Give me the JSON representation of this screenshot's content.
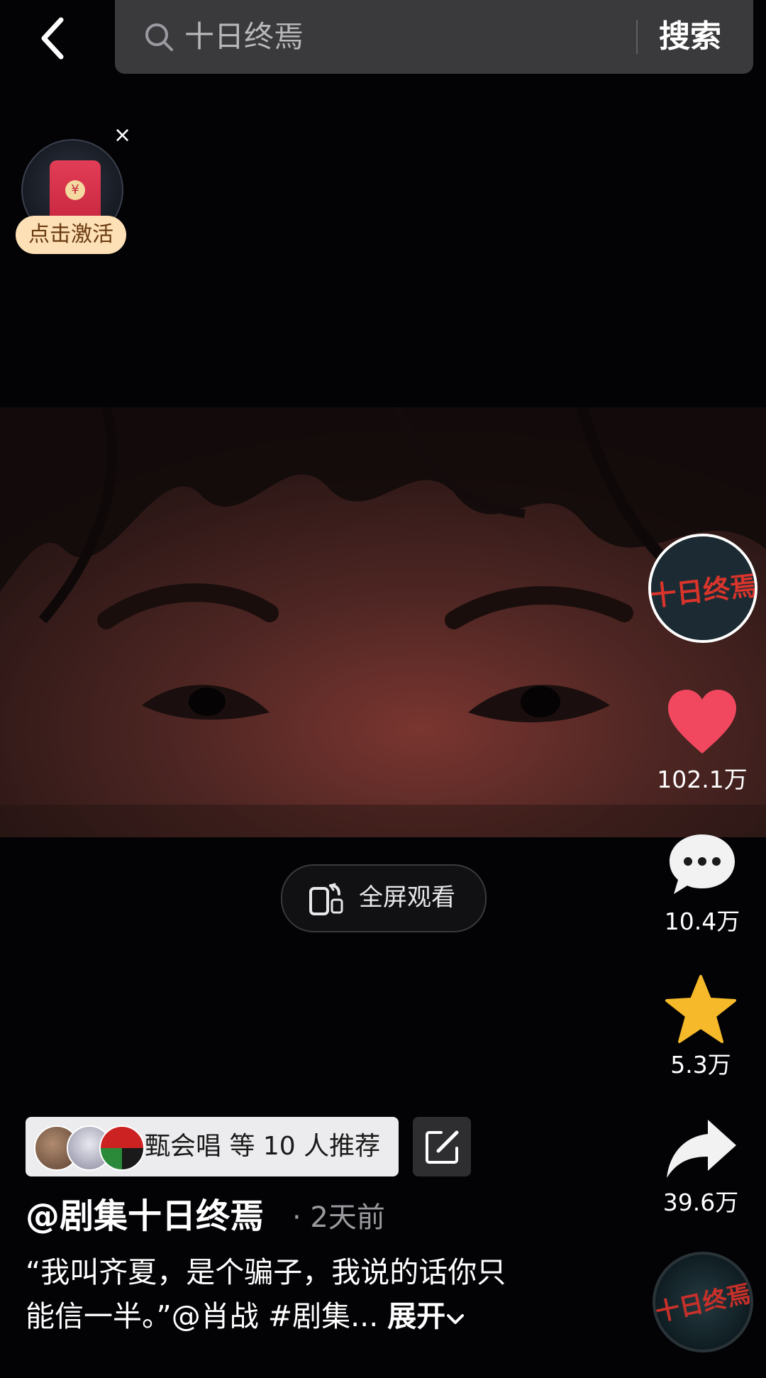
{
  "search": {
    "query": "十日终焉",
    "button_label": "搜索"
  },
  "red_packet": {
    "label": "点击激活",
    "close_glyph": "×",
    "coin_glyph": "¥"
  },
  "video": {
    "fullscreen_label": "全屏观看"
  },
  "creator": {
    "avatar_text": "十日终焉"
  },
  "actions": {
    "likes": "102.1万",
    "comments": "10.4万",
    "favorites": "5.3万",
    "shares": "39.6万"
  },
  "recommend": {
    "text": "甄会唱 等 10 人推荐"
  },
  "post": {
    "author": "@剧集十日终焉",
    "time": "· 2天前",
    "caption_line1": "“我叫齐夏，是个骗子，我说的话你只",
    "caption_line2": "能信一半。”@肖战 #剧集... ",
    "expand_label": "展开"
  },
  "colors": {
    "like": "#f1485f",
    "favorite": "#f5b92a",
    "search_bg": "#3a3a3c",
    "chip_bg": "#ececee"
  }
}
